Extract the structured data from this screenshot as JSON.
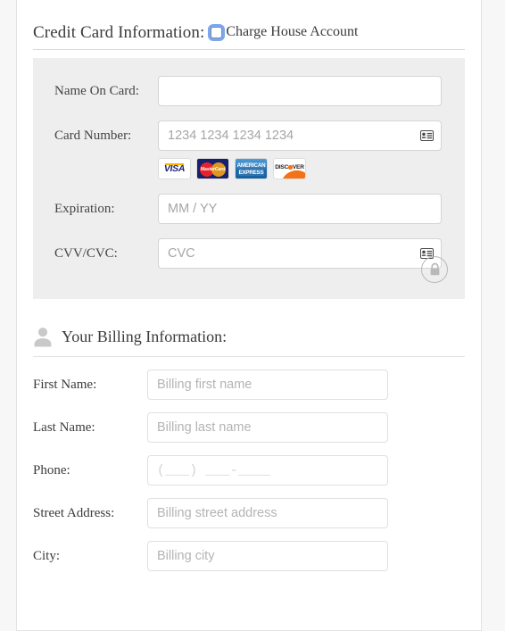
{
  "credit_card": {
    "title": "Credit Card Information:",
    "house_account": {
      "label": "Charge House Account",
      "checked": false,
      "focus_ring_color": "#7aa7f0"
    },
    "fields": [
      {
        "label": "Name On Card:",
        "value": "",
        "placeholder": "",
        "icon": ""
      },
      {
        "label": "Card Number:",
        "value": "",
        "placeholder": "1234 1234 1234 1234",
        "icon": "autofill-card-icon"
      },
      {
        "label": "Expiration:",
        "value": "",
        "placeholder": "MM / YY",
        "icon": ""
      },
      {
        "label": "CVV/CVC:",
        "value": "",
        "placeholder": "CVC",
        "icon": "autofill-card-icon"
      }
    ],
    "accepted_brands": [
      {
        "name": "visa",
        "text": "VISA"
      },
      {
        "name": "mastercard",
        "text": "MasterCard"
      },
      {
        "name": "american-express",
        "line1": "AMERICAN",
        "line2": "EXPRESS"
      },
      {
        "name": "discover",
        "text_before": "DISC",
        "text_after": "VER"
      }
    ],
    "secure_badge": "lock-icon",
    "panel_color": "#eeeeee"
  },
  "billing": {
    "icon": "person-icon",
    "title": "Your Billing Information:",
    "fields": [
      {
        "label": "First Name:",
        "value": "",
        "placeholder": "Billing first name"
      },
      {
        "label": "Last Name:",
        "value": "",
        "placeholder": "Billing last name"
      },
      {
        "label": "Phone:",
        "value": "",
        "placeholder": "(___) ___-____"
      },
      {
        "label": "Street Address:",
        "value": "",
        "placeholder": "Billing street address"
      },
      {
        "label": "City:",
        "value": "",
        "placeholder": "Billing city"
      }
    ]
  }
}
